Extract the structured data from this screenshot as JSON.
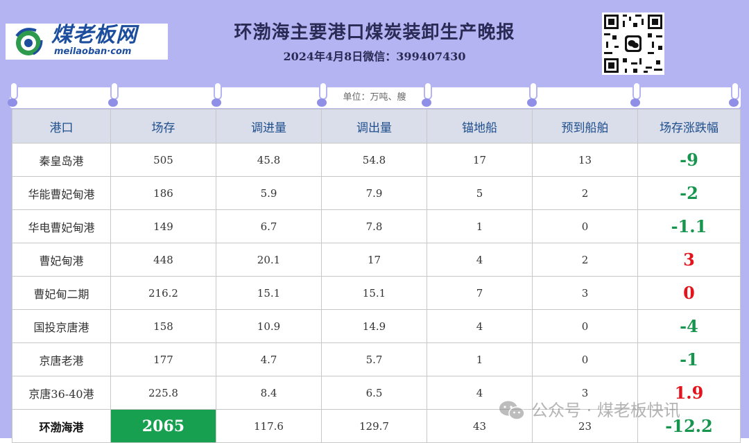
{
  "header": {
    "logo_cn": "煤老板网",
    "logo_en": "meilaoban·com",
    "title": "环渤海主要港口煤炭装卸生产晚报",
    "subtitle": "2024年4月8日微信：399407430"
  },
  "table": {
    "unit": "单位：万吨、艘",
    "headers": [
      "港口",
      "场存",
      "调进量",
      "调出量",
      "锚地船",
      "预到船舶",
      "场存涨跌幅"
    ],
    "rows": [
      {
        "port": "秦皇岛港",
        "stock": "505",
        "in": "45.8",
        "out": "54.8",
        "anchor": "17",
        "expected": "13",
        "change": "-9",
        "direction": "down"
      },
      {
        "port": "华能曹妃甸港",
        "stock": "186",
        "in": "5.9",
        "out": "7.9",
        "anchor": "5",
        "expected": "2",
        "change": "-2",
        "direction": "down"
      },
      {
        "port": "华电曹妃甸港",
        "stock": "149",
        "in": "6.7",
        "out": "7.8",
        "anchor": "1",
        "expected": "0",
        "change": "-1.1",
        "direction": "down"
      },
      {
        "port": "曹妃甸港",
        "stock": "448",
        "in": "20.1",
        "out": "17",
        "anchor": "4",
        "expected": "2",
        "change": "3",
        "direction": "up"
      },
      {
        "port": "曹妃甸二期",
        "stock": "216.2",
        "in": "15.1",
        "out": "15.1",
        "anchor": "7",
        "expected": "3",
        "change": "0",
        "direction": "up"
      },
      {
        "port": "国投京唐港",
        "stock": "158",
        "in": "10.9",
        "out": "14.9",
        "anchor": "4",
        "expected": "0",
        "change": "-4",
        "direction": "down"
      },
      {
        "port": "京唐老港",
        "stock": "177",
        "in": "4.7",
        "out": "5.7",
        "anchor": "1",
        "expected": "0",
        "change": "-1",
        "direction": "down"
      },
      {
        "port": "京唐36-40港",
        "stock": "225.8",
        "in": "8.4",
        "out": "6.5",
        "anchor": "4",
        "expected": "3",
        "change": "1.9",
        "direction": "up"
      }
    ],
    "total": {
      "port": "环渤海港",
      "stock": "2065",
      "in": "117.6",
      "out": "129.7",
      "anchor": "43",
      "expected": "23",
      "change": "-12.2",
      "direction": "down"
    }
  },
  "watermark": {
    "text": "公众号 · 煤老板快讯",
    "icon": "wechat-icon"
  },
  "colors": {
    "background": "#b4b4f3",
    "header_row": "#d9deea",
    "header_text": "#1f4e8c",
    "decrease": "#17944d",
    "increase": "#e3141b",
    "total_highlight": "#17a050",
    "logo_blue": "#1d4e9e"
  },
  "icons": {
    "logo": "meilaoban-logo-icon",
    "qr": "wechat-qr-code-icon"
  }
}
